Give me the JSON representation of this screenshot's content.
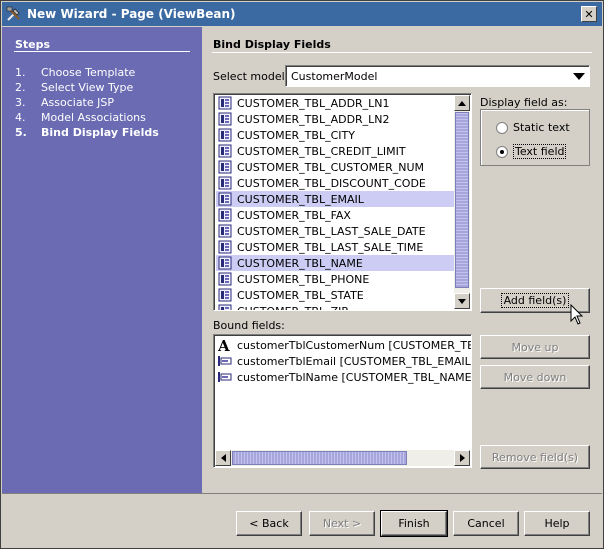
{
  "window": {
    "title": "New Wizard - Page (ViewBean)",
    "close_glyph": "✕"
  },
  "steps": {
    "heading": "Steps",
    "items": [
      {
        "num": "1.",
        "label": "Choose Template"
      },
      {
        "num": "2.",
        "label": "Select View Type"
      },
      {
        "num": "3.",
        "label": "Associate JSP"
      },
      {
        "num": "4.",
        "label": "Model Associations"
      },
      {
        "num": "5.",
        "label": "Bind Display Fields"
      }
    ],
    "current_index": 4
  },
  "main": {
    "heading": "Bind Display Fields",
    "select_model_label": "Select model:",
    "select_model_value": "CustomerModel",
    "fields": [
      {
        "label": "CUSTOMER_TBL_ADDR_LN1",
        "selected": false
      },
      {
        "label": "CUSTOMER_TBL_ADDR_LN2",
        "selected": false
      },
      {
        "label": "CUSTOMER_TBL_CITY",
        "selected": false
      },
      {
        "label": "CUSTOMER_TBL_CREDIT_LIMIT",
        "selected": false
      },
      {
        "label": "CUSTOMER_TBL_CUSTOMER_NUM",
        "selected": false
      },
      {
        "label": "CUSTOMER_TBL_DISCOUNT_CODE",
        "selected": false
      },
      {
        "label": "CUSTOMER_TBL_EMAIL",
        "selected": true
      },
      {
        "label": "CUSTOMER_TBL_FAX",
        "selected": false
      },
      {
        "label": "CUSTOMER_TBL_LAST_SALE_DATE",
        "selected": false
      },
      {
        "label": "CUSTOMER_TBL_LAST_SALE_TIME",
        "selected": false
      },
      {
        "label": "CUSTOMER_TBL_NAME",
        "selected": true
      },
      {
        "label": "CUSTOMER_TBL_PHONE",
        "selected": false
      },
      {
        "label": "CUSTOMER_TBL_STATE",
        "selected": false
      },
      {
        "label": "CUSTOMER_TBL_ZIP",
        "selected": false
      }
    ],
    "display_as": {
      "label": "Display field as:",
      "options": [
        "Static text",
        "Text field"
      ],
      "selected": "Text field"
    },
    "bound_fields_label": "Bound fields:",
    "bound_fields": [
      {
        "icon": "static-text-icon",
        "label": "customerTblCustomerNum [CUSTOMER_TBL_CUS"
      },
      {
        "icon": "text-field-icon",
        "label": "customerTblEmail [CUSTOMER_TBL_EMAIL]"
      },
      {
        "icon": "text-field-icon",
        "label": "customerTblName [CUSTOMER_TBL_NAME]"
      }
    ],
    "buttons": {
      "add": "Add field(s)",
      "move_up": "Move up",
      "move_down": "Move down",
      "remove": "Remove field(s)"
    }
  },
  "footer": {
    "back": "< Back",
    "next": "Next >",
    "finish": "Finish",
    "cancel": "Cancel",
    "help": "Help"
  }
}
